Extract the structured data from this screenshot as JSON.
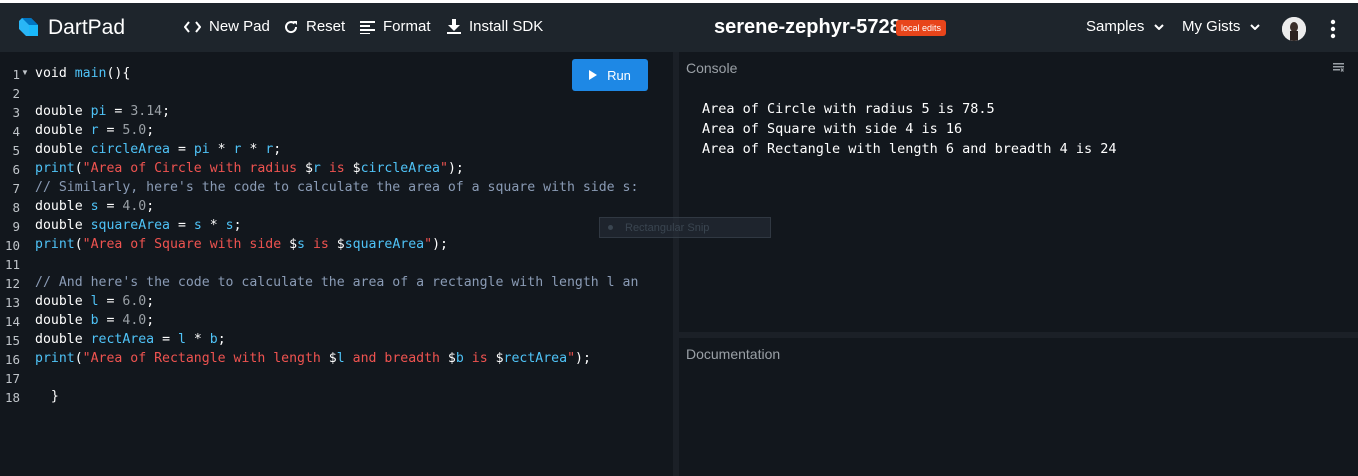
{
  "app": {
    "name": "DartPad"
  },
  "toolbar": {
    "new_pad": "New Pad",
    "reset": "Reset",
    "format": "Format",
    "install_sdk": "Install SDK"
  },
  "pad": {
    "title": "serene-zephyr-5728",
    "badge": "local edits"
  },
  "menus": {
    "samples": "Samples",
    "my_gists": "My Gists"
  },
  "editor": {
    "run_label": "Run",
    "line_numbers": [
      "1",
      "2",
      "3",
      "4",
      "5",
      "6",
      "7",
      "8",
      "9",
      "10",
      "11",
      "12",
      "13",
      "14",
      "15",
      "16",
      "17",
      "18"
    ]
  },
  "console": {
    "label": "Console",
    "lines": [
      "Area of Circle with radius 5 is 78.5",
      "Area of Square with side 4 is 16",
      "Area of Rectangle with length 6 and breadth 4 is 24"
    ]
  },
  "documentation": {
    "label": "Documentation"
  },
  "overlay": {
    "snip_label": "Rectangular Snip"
  },
  "colors": {
    "accent": "#1e88e5",
    "badge": "#e8451b",
    "topbar": "#1e252c",
    "background": "#12171d"
  }
}
